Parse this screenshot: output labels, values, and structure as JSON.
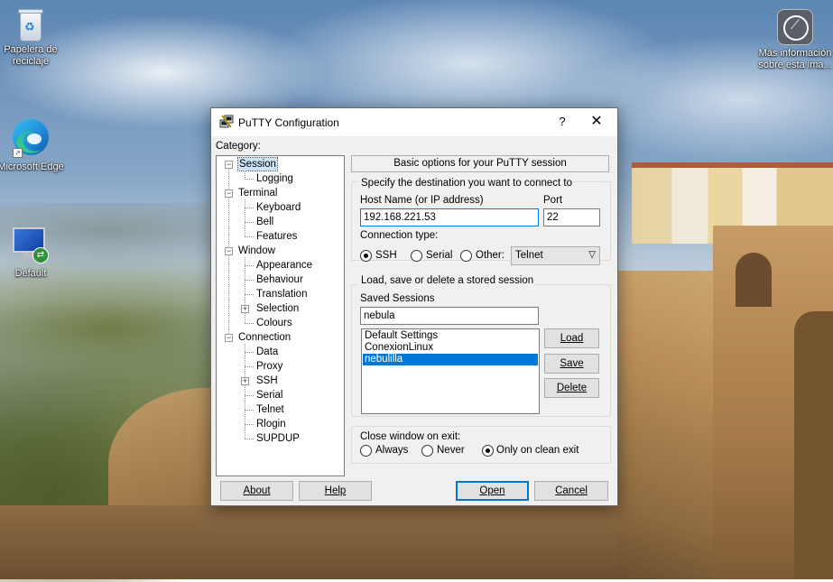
{
  "desktop": {
    "icons": [
      {
        "label": "Papelera de reciclaje",
        "icon": "recycle-bin-icon"
      },
      {
        "label": "Microsoft Edge",
        "icon": "edge-icon"
      },
      {
        "label": "Default",
        "icon": "remote-desktop-icon"
      },
      {
        "label": "Más información sobre esta ima...",
        "icon": "camera-info-icon"
      }
    ]
  },
  "window": {
    "title": "PuTTY Configuration",
    "help_glyph": "?",
    "close_glyph": "✕",
    "category_label": "Category:"
  },
  "tree": {
    "session": "Session",
    "logging": "Logging",
    "terminal": "Terminal",
    "keyboard": "Keyboard",
    "bell": "Bell",
    "features": "Features",
    "window": "Window",
    "appearance": "Appearance",
    "behaviour": "Behaviour",
    "translation": "Translation",
    "selection": "Selection",
    "colours": "Colours",
    "connection": "Connection",
    "data": "Data",
    "proxy": "Proxy",
    "ssh": "SSH",
    "serial": "Serial",
    "telnet": "Telnet",
    "rlogin": "Rlogin",
    "supdup": "SUPDUP"
  },
  "session": {
    "header": "Basic options for your PuTTY session",
    "dest_group": "Specify the destination you want to connect to",
    "host_label": "Host Name (or IP address)",
    "host_value": "192.168.221.53",
    "port_label": "Port",
    "port_value": "22",
    "conn_type_label": "Connection type:",
    "conn_types": {
      "ssh": "SSH",
      "serial": "Serial",
      "other": "Other:"
    },
    "conn_type_selected": "SSH",
    "other_select_value": "Telnet",
    "stored_group": "Load, save or delete a stored session",
    "saved_sessions_label": "Saved Sessions",
    "saved_sessions_input": "nebula",
    "sessions_list": [
      "Default Settings",
      "ConexionLinux",
      "nebulilla"
    ],
    "selected_session": "nebulilla",
    "load_label": "Load",
    "save_label": "Save",
    "delete_label": "Delete",
    "close_group": "Close window on exit:",
    "close_options": {
      "always": "Always",
      "never": "Never",
      "clean": "Only on clean exit"
    },
    "close_selected": "Only on clean exit"
  },
  "footer": {
    "about": "About",
    "help": "Help",
    "open": "Open",
    "cancel": "Cancel"
  }
}
